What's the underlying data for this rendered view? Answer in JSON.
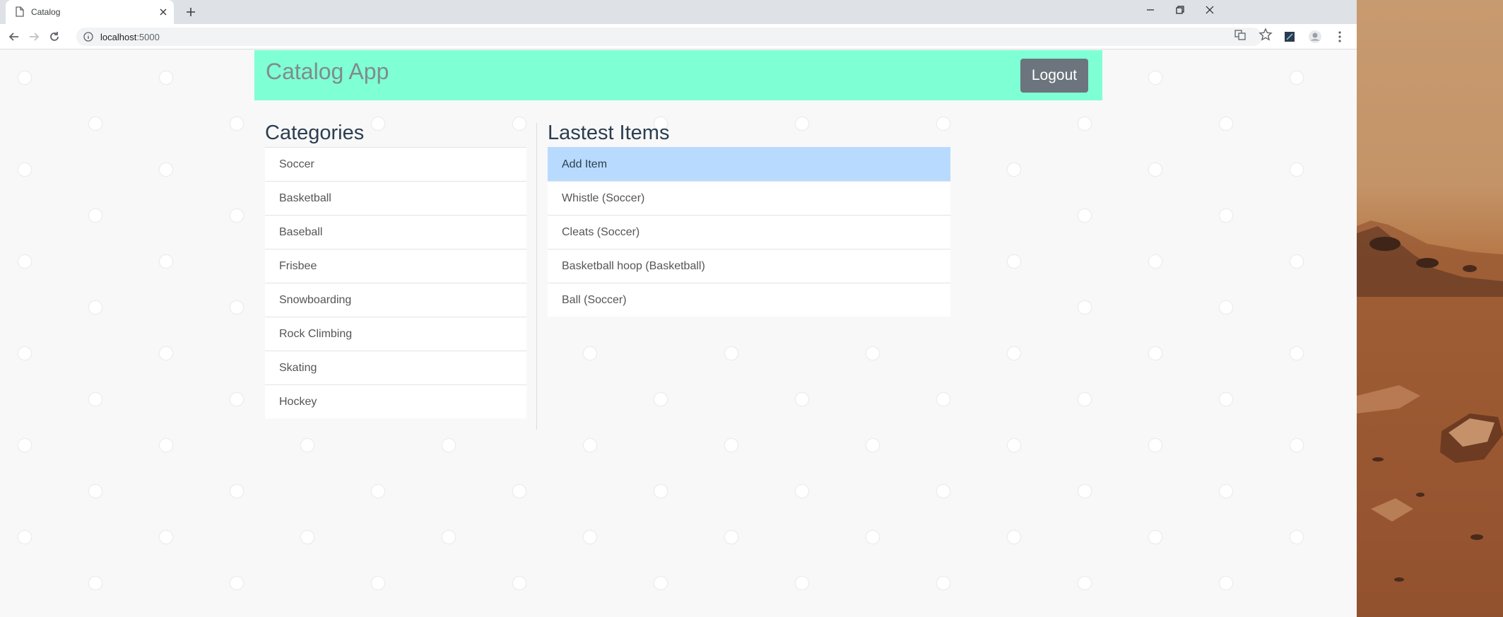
{
  "browser": {
    "tab_title": "Catalog",
    "url_host": "localhost",
    "url_port": ":5000"
  },
  "app": {
    "brand": "Catalog App",
    "logout_label": "Logout",
    "brand_bg": "#7fffd4"
  },
  "categories": {
    "heading": "Categories",
    "items": [
      "Soccer",
      "Basketball",
      "Baseball",
      "Frisbee",
      "Snowboarding",
      "Rock Climbing",
      "Skating",
      "Hockey"
    ]
  },
  "latest": {
    "heading": "Lastest Items",
    "add_label": "Add Item",
    "items": [
      "Whistle (Soccer)",
      "Cleats (Soccer)",
      "Basketball hoop (Basketball)",
      "Ball (Soccer)"
    ]
  }
}
